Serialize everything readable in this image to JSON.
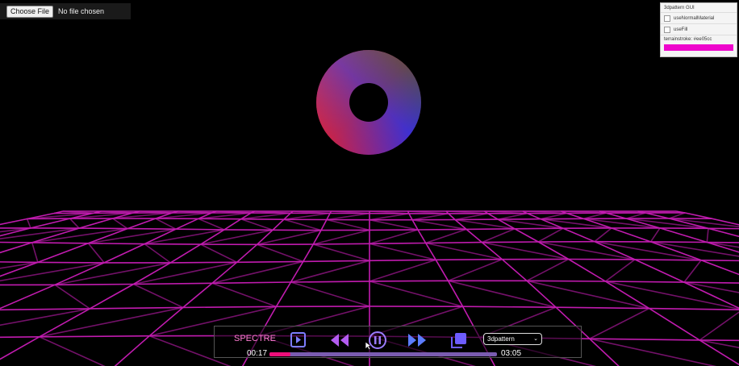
{
  "file_input": {
    "button_label": "Choose File",
    "status": "No file chosen"
  },
  "gui": {
    "title": "3dpattern GUI",
    "options": [
      {
        "label": "useNormalMaterial",
        "checked": false
      },
      {
        "label": "useFill",
        "checked": false
      }
    ],
    "terrain_stroke_label": "terrainstroke: #ee05cc",
    "terrain_stroke_color": "#ee05cc"
  },
  "player": {
    "brand": "SPECTRE",
    "current_time": "00:17",
    "duration": "03:05",
    "progress_fraction": 0.092,
    "mode_select": "3dpattern",
    "accent_color": "#ee0f7a"
  }
}
